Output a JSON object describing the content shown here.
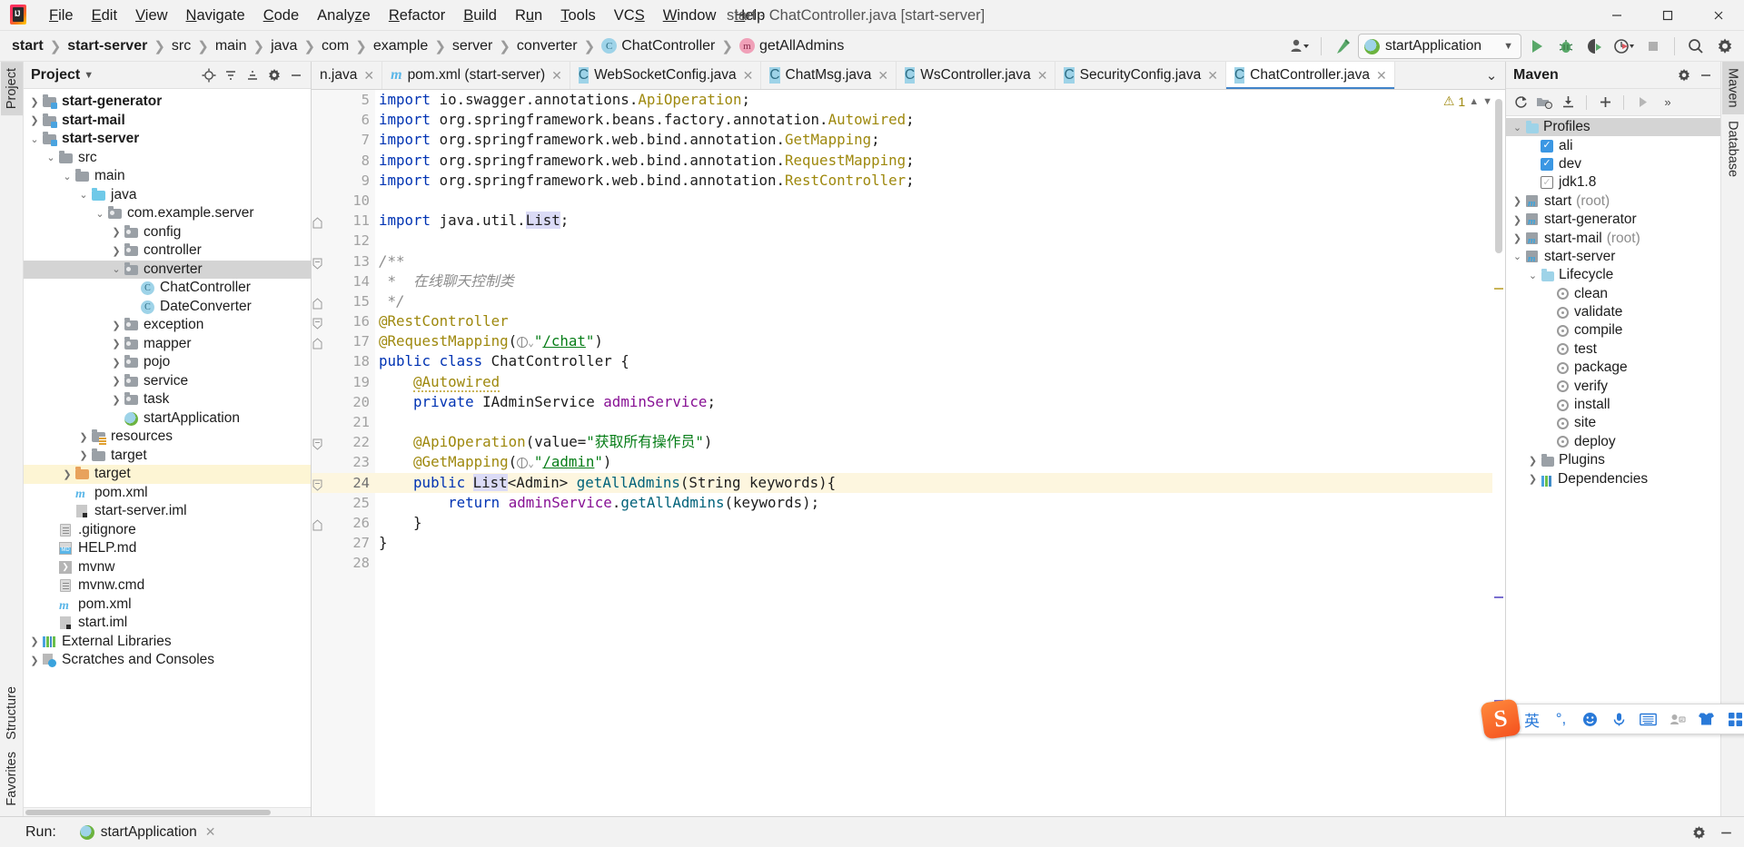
{
  "window": {
    "title": "start - ChatController.java [start-server]",
    "logo_text": "IJ",
    "minimize": "minimize-button",
    "maximize": "maximize-button",
    "close": "close-button"
  },
  "menubar": {
    "items": [
      {
        "label": "File",
        "mnemonic": "F"
      },
      {
        "label": "Edit",
        "mnemonic": "E"
      },
      {
        "label": "View",
        "mnemonic": "V"
      },
      {
        "label": "Navigate",
        "mnemonic": "N"
      },
      {
        "label": "Code",
        "mnemonic": "C"
      },
      {
        "label": "Analyze",
        "mnemonic": "z"
      },
      {
        "label": "Refactor",
        "mnemonic": "R"
      },
      {
        "label": "Build",
        "mnemonic": "B"
      },
      {
        "label": "Run",
        "mnemonic": "u"
      },
      {
        "label": "Tools",
        "mnemonic": "T"
      },
      {
        "label": "VCS",
        "mnemonic": "S"
      },
      {
        "label": "Window",
        "mnemonic": "W"
      },
      {
        "label": "Help",
        "mnemonic": "H"
      }
    ]
  },
  "breadcrumb": {
    "items": [
      {
        "label": "start",
        "bold": true,
        "icon": ""
      },
      {
        "label": "start-server",
        "bold": true,
        "icon": ""
      },
      {
        "label": "src",
        "bold": false,
        "icon": ""
      },
      {
        "label": "main",
        "bold": false,
        "icon": ""
      },
      {
        "label": "java",
        "bold": false,
        "icon": ""
      },
      {
        "label": "com",
        "bold": false,
        "icon": ""
      },
      {
        "label": "example",
        "bold": false,
        "icon": ""
      },
      {
        "label": "server",
        "bold": false,
        "icon": ""
      },
      {
        "label": "converter",
        "bold": false,
        "icon": ""
      },
      {
        "label": "ChatController",
        "bold": false,
        "icon": "class-icon",
        "glyph": "C"
      },
      {
        "label": "getAllAdmins",
        "bold": false,
        "icon": "method-icon",
        "glyph": "m"
      }
    ],
    "separator": "❯"
  },
  "toolbar": {
    "run_config": "startApplication",
    "icons": [
      "user-avatar-icon",
      "hammer-build-icon",
      "run-icon",
      "debug-icon",
      "run-with-coverage-icon",
      "profiler-icon",
      "stop-icon",
      "search-everywhere-icon",
      "settings-gear-icon"
    ]
  },
  "left_strip": {
    "tabs": [
      "Project",
      "Favorites",
      "Structure"
    ]
  },
  "right_strip": {
    "tabs": [
      "Maven",
      "Database"
    ]
  },
  "project_panel": {
    "title": "Project",
    "header_icons": [
      "locate-icon",
      "collapse-all-icon",
      "expand-all-icon",
      "settings-gear-icon",
      "hide-icon"
    ],
    "tree": [
      {
        "depth": 1,
        "label": "start-generator",
        "icon": "module-folder-icon",
        "arrow": "collapsed",
        "bold": true
      },
      {
        "depth": 1,
        "label": "start-mail",
        "icon": "module-folder-icon",
        "arrow": "collapsed",
        "bold": true
      },
      {
        "depth": 1,
        "label": "start-server",
        "icon": "module-folder-icon",
        "arrow": "expanded",
        "bold": true
      },
      {
        "depth": 2,
        "label": "src",
        "icon": "folder-icon",
        "arrow": "expanded",
        "bold": false
      },
      {
        "depth": 3,
        "label": "main",
        "icon": "folder-icon",
        "arrow": "expanded",
        "bold": false
      },
      {
        "depth": 4,
        "label": "java",
        "icon": "source-folder-icon",
        "arrow": "expanded",
        "bold": false
      },
      {
        "depth": 5,
        "label": "com.example.server",
        "icon": "package-icon",
        "arrow": "expanded",
        "bold": false
      },
      {
        "depth": 6,
        "label": "config",
        "icon": "package-icon",
        "arrow": "collapsed",
        "bold": false
      },
      {
        "depth": 6,
        "label": "controller",
        "icon": "package-icon",
        "arrow": "collapsed",
        "bold": false
      },
      {
        "depth": 6,
        "label": "converter",
        "icon": "package-icon",
        "arrow": "expanded",
        "bold": false,
        "selected": true
      },
      {
        "depth": 7,
        "label": "ChatController",
        "icon": "class-icon",
        "arrow": "none",
        "bold": false
      },
      {
        "depth": 7,
        "label": "DateConverter",
        "icon": "class-icon",
        "arrow": "none",
        "bold": false
      },
      {
        "depth": 6,
        "label": "exception",
        "icon": "package-icon",
        "arrow": "collapsed",
        "bold": false
      },
      {
        "depth": 6,
        "label": "mapper",
        "icon": "package-icon",
        "arrow": "collapsed",
        "bold": false
      },
      {
        "depth": 6,
        "label": "pojo",
        "icon": "package-icon",
        "arrow": "collapsed",
        "bold": false
      },
      {
        "depth": 6,
        "label": "service",
        "icon": "package-icon",
        "arrow": "collapsed",
        "bold": false
      },
      {
        "depth": 6,
        "label": "task",
        "icon": "package-icon",
        "arrow": "collapsed",
        "bold": false
      },
      {
        "depth": 6,
        "label": "startApplication",
        "icon": "spring-boot-class-icon",
        "arrow": "none",
        "bold": false
      },
      {
        "depth": 4,
        "label": "resources",
        "icon": "resources-folder-icon",
        "arrow": "collapsed",
        "bold": false
      },
      {
        "depth": 4,
        "label": "target",
        "icon": "folder-icon",
        "arrow": "collapsed",
        "bold": false
      },
      {
        "depth": 3,
        "label": "target",
        "icon": "excluded-folder-icon",
        "arrow": "collapsed",
        "bold": false,
        "highlighted": true
      },
      {
        "depth": 3,
        "label": "pom.xml",
        "icon": "maven-file-icon",
        "arrow": "none",
        "bold": false
      },
      {
        "depth": 3,
        "label": "start-server.iml",
        "icon": "iml-file-icon",
        "arrow": "none",
        "bold": false
      },
      {
        "depth": 2,
        "label": ".gitignore",
        "icon": "text-file-icon",
        "arrow": "none",
        "bold": false
      },
      {
        "depth": 2,
        "label": "HELP.md",
        "icon": "markdown-file-icon",
        "arrow": "none",
        "bold": false
      },
      {
        "depth": 2,
        "label": "mvnw",
        "icon": "shell-file-icon",
        "arrow": "none",
        "bold": false
      },
      {
        "depth": 2,
        "label": "mvnw.cmd",
        "icon": "text-file-icon",
        "arrow": "none",
        "bold": false
      },
      {
        "depth": 2,
        "label": "pom.xml",
        "icon": "maven-file-icon",
        "arrow": "none",
        "bold": false
      },
      {
        "depth": 2,
        "label": "start.iml",
        "icon": "iml-file-icon",
        "arrow": "none",
        "bold": false
      },
      {
        "depth": 1,
        "label": "External Libraries",
        "icon": "libraries-icon",
        "arrow": "collapsed",
        "bold": false
      },
      {
        "depth": 1,
        "label": "Scratches and Consoles",
        "icon": "scratches-icon",
        "arrow": "collapsed",
        "bold": false
      }
    ]
  },
  "editor_tabs": {
    "tabs": [
      {
        "label": "n.java",
        "icon": "class-icon",
        "active": false,
        "truncated": true
      },
      {
        "label": "pom.xml (start-server)",
        "icon": "maven-file-icon",
        "active": false
      },
      {
        "label": "WebSocketConfig.java",
        "icon": "class-icon",
        "active": false
      },
      {
        "label": "ChatMsg.java",
        "icon": "class-icon",
        "active": false
      },
      {
        "label": "WsController.java",
        "icon": "class-icon",
        "active": false
      },
      {
        "label": "SecurityConfig.java",
        "icon": "class-icon",
        "active": false
      },
      {
        "label": "ChatController.java",
        "icon": "class-icon",
        "active": true
      }
    ],
    "close_glyph": "✕",
    "chevron": "⌄"
  },
  "editor": {
    "warning_count": "1",
    "warning_glyph": "⚠",
    "first_line_number": 5,
    "caret_line": 24,
    "lines": [
      {
        "n": 5,
        "gutter_icon": "",
        "fold": "",
        "html": "<span class='kw'>import</span> io.swagger.annotations.<span class='ann'>ApiOperation</span>;"
      },
      {
        "n": 6,
        "gutter_icon": "",
        "fold": "",
        "html": "<span class='kw'>import</span> org.springframework.beans.factory.annotation.<span class='ann'>Autowired</span>;"
      },
      {
        "n": 7,
        "gutter_icon": "",
        "fold": "",
        "html": "<span class='kw'>import</span> org.springframework.web.bind.annotation.<span class='ann'>GetMapping</span>;"
      },
      {
        "n": 8,
        "gutter_icon": "",
        "fold": "",
        "html": "<span class='kw'>import</span> org.springframework.web.bind.annotation.<span class='ann'>RequestMapping</span>;"
      },
      {
        "n": 9,
        "gutter_icon": "",
        "fold": "",
        "html": "<span class='kw'>import</span> org.springframework.web.bind.annotation.<span class='ann'>RestController</span>;"
      },
      {
        "n": 10,
        "gutter_icon": "",
        "fold": "",
        "html": ""
      },
      {
        "n": 11,
        "gutter_icon": "",
        "fold": "end",
        "html": "<span class='kw'>import</span> java.util.<span class='hlt'>List</span>;"
      },
      {
        "n": 12,
        "gutter_icon": "",
        "fold": "",
        "html": ""
      },
      {
        "n": 13,
        "gutter_icon": "",
        "fold": "start",
        "html": "<span class='cmt'>/**</span>"
      },
      {
        "n": 14,
        "gutter_icon": "",
        "fold": "",
        "html": "<span class='cmt'> *  在线聊天控制类</span>"
      },
      {
        "n": 15,
        "gutter_icon": "",
        "fold": "end",
        "html": "<span class='cmt'> */</span>"
      },
      {
        "n": 16,
        "gutter_icon": "",
        "fold": "start",
        "html": "<span class='ann'>@RestController</span>"
      },
      {
        "n": 17,
        "gutter_icon": "",
        "fold": "end",
        "html": "<span class='ann'>@RequestMapping</span>(<span class='globe'></span><span class='chev-s'>⌄</span><span class='str'>\"<u>/chat</u>\"</span>)"
      },
      {
        "n": 18,
        "gutter_icon": "spring-bean-icon",
        "fold": "",
        "html": "<span class='kw'>public class</span> ChatController {"
      },
      {
        "n": 19,
        "gutter_icon": "",
        "fold": "",
        "html": "    <span class='ann squig'>@Autowired</span>"
      },
      {
        "n": 20,
        "gutter_icon": "bean-arrow-icon",
        "fold": "",
        "html": "    <span class='kw'>private</span> IAdminService <span class='fld'>adminService</span>;"
      },
      {
        "n": 21,
        "gutter_icon": "",
        "fold": "",
        "html": ""
      },
      {
        "n": 22,
        "gutter_icon": "",
        "fold": "start",
        "html": "    <span class='ann'>@ApiOperation</span>(value=<span class='str'>\"获取所有操作员\"</span>)"
      },
      {
        "n": 23,
        "gutter_icon": "",
        "fold": "",
        "html": "    <span class='ann'>@GetMapping</span>(<span class='globe'></span><span class='chev-s'>⌄</span><span class='str'>\"<u>/admin</u>\"</span>)"
      },
      {
        "n": 24,
        "gutter_icon": "spring-bean-icon",
        "fold": "start",
        "html": "    <span class='kw'>public</span> <span class='caret'></span><span class='hlt'>List</span>&lt;Admin&gt; <span class='mth'>getAllAdmins</span>(String keywords){"
      },
      {
        "n": 25,
        "gutter_icon": "",
        "fold": "",
        "html": "        <span class='kw'>return</span> <span class='fld'>adminService</span>.<span class='mth'>getAllAdmins</span>(keywords);"
      },
      {
        "n": 26,
        "gutter_icon": "",
        "fold": "end",
        "html": "    }"
      },
      {
        "n": 27,
        "gutter_icon": "",
        "fold": "",
        "html": "}"
      },
      {
        "n": 28,
        "gutter_icon": "",
        "fold": "",
        "html": ""
      }
    ]
  },
  "maven_panel": {
    "title": "Maven",
    "toolbar_icons": [
      "reimport-icon",
      "generate-sources-icon",
      "download-sources-icon",
      "add-maven-project-icon",
      "run-maven-build-icon",
      "expand-more-icon"
    ],
    "header_icons": [
      "settings-gear-icon",
      "hide-icon"
    ],
    "tree": [
      {
        "depth": 0,
        "label": "Profiles",
        "icon": "profiles-folder-icon",
        "arrow": "expanded",
        "selected": true
      },
      {
        "depth": 1,
        "label": "ali",
        "icon": "checkbox",
        "checked": true,
        "arrow": "none"
      },
      {
        "depth": 1,
        "label": "dev",
        "icon": "checkbox",
        "checked": true,
        "arrow": "none"
      },
      {
        "depth": 1,
        "label": "jdk1.8",
        "icon": "checkbox",
        "checked": false,
        "arrow": "none"
      },
      {
        "depth": 0,
        "label": "start",
        "suffix": "(root)",
        "icon": "maven-project-icon",
        "arrow": "collapsed"
      },
      {
        "depth": 0,
        "label": "start-generator",
        "suffix": "",
        "icon": "maven-project-icon",
        "arrow": "collapsed"
      },
      {
        "depth": 0,
        "label": "start-mail",
        "suffix": "(root)",
        "icon": "maven-project-icon",
        "arrow": "collapsed"
      },
      {
        "depth": 0,
        "label": "start-server",
        "suffix": "",
        "icon": "maven-project-icon",
        "arrow": "expanded"
      },
      {
        "depth": 1,
        "label": "Lifecycle",
        "icon": "lifecycle-folder-icon",
        "arrow": "expanded"
      },
      {
        "depth": 2,
        "label": "clean",
        "icon": "maven-goal-icon",
        "arrow": "none"
      },
      {
        "depth": 2,
        "label": "validate",
        "icon": "maven-goal-icon",
        "arrow": "none"
      },
      {
        "depth": 2,
        "label": "compile",
        "icon": "maven-goal-icon",
        "arrow": "none"
      },
      {
        "depth": 2,
        "label": "test",
        "icon": "maven-goal-icon",
        "arrow": "none"
      },
      {
        "depth": 2,
        "label": "package",
        "icon": "maven-goal-icon",
        "arrow": "none"
      },
      {
        "depth": 2,
        "label": "verify",
        "icon": "maven-goal-icon",
        "arrow": "none"
      },
      {
        "depth": 2,
        "label": "install",
        "icon": "maven-goal-icon",
        "arrow": "none"
      },
      {
        "depth": 2,
        "label": "site",
        "icon": "maven-goal-icon",
        "arrow": "none"
      },
      {
        "depth": 2,
        "label": "deploy",
        "icon": "maven-goal-icon",
        "arrow": "none"
      },
      {
        "depth": 1,
        "label": "Plugins",
        "icon": "plugins-folder-icon",
        "arrow": "collapsed"
      },
      {
        "depth": 1,
        "label": "Dependencies",
        "icon": "dependencies-icon",
        "arrow": "collapsed"
      }
    ]
  },
  "bottom_bar": {
    "run_label": "Run:",
    "active_tab": "startApplication",
    "tab_icon": "spring-boot-class-icon",
    "close_glyph": "✕",
    "right_icons": [
      "settings-gear-icon",
      "hide-icon"
    ]
  },
  "ime_bar": {
    "logo": "S",
    "items": [
      "英",
      "°,",
      "emoji-icon",
      "microphone-icon",
      "keyboard-icon",
      "user-card-icon",
      "skin-icon",
      "apps-grid-icon"
    ]
  },
  "colors": {
    "accent": "#4083c9",
    "keyword": "#0033b3",
    "annotation": "#9e880d",
    "string": "#067d17",
    "comment": "#8c8c8c",
    "field": "#871094",
    "method": "#00627a",
    "caret_line": "#fdf6df",
    "selection": "#d4d4d4",
    "highlight_row": "#fdf5d4"
  }
}
